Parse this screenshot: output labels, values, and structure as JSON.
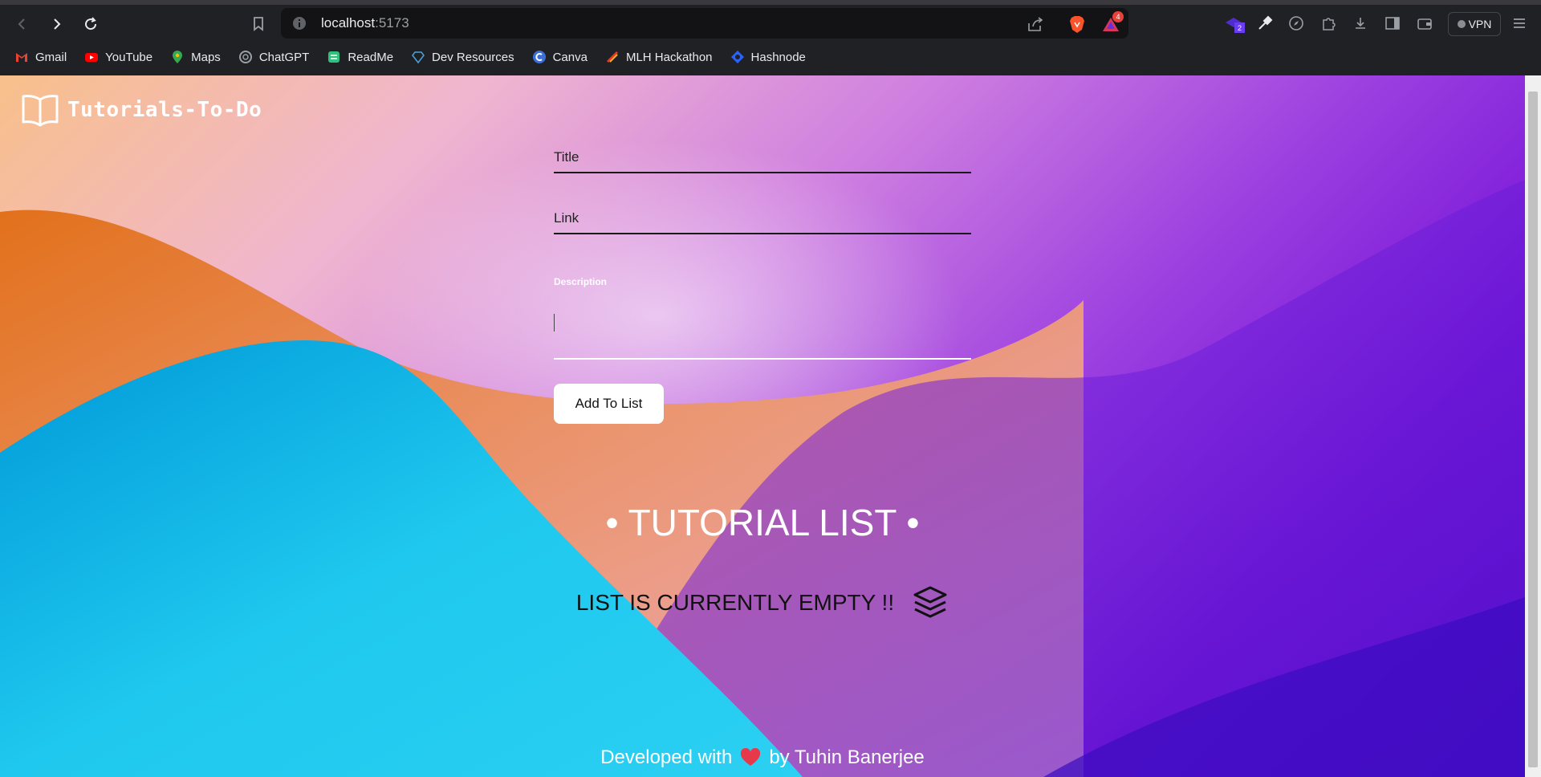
{
  "browser": {
    "url_host": "localhost",
    "url_port": ":5173",
    "vpn_label": "VPN",
    "shields_badge": "4",
    "ext_badge": "2"
  },
  "bookmarks": [
    {
      "label": "Gmail",
      "icon": "gmail-icon",
      "color": "#ea4335"
    },
    {
      "label": "YouTube",
      "icon": "youtube-icon",
      "color": "#ff0000"
    },
    {
      "label": "Maps",
      "icon": "maps-icon",
      "color": "#34a853"
    },
    {
      "label": "ChatGPT",
      "icon": "chatgpt-icon",
      "color": "#9aa0a6"
    },
    {
      "label": "ReadMe",
      "icon": "readme-icon",
      "color": "#2ec27e"
    },
    {
      "label": "Dev Resources",
      "icon": "diamond-icon",
      "color": "#4aa3df"
    },
    {
      "label": "Canva",
      "icon": "canva-icon",
      "color": "#00c4cc"
    },
    {
      "label": "MLH Hackathon",
      "icon": "mlh-icon",
      "color": "#e73427"
    },
    {
      "label": "Hashnode",
      "icon": "hashnode-icon",
      "color": "#2962ff"
    }
  ],
  "app": {
    "brand": "Tutorials-To-Do",
    "title_placeholder": "Title",
    "link_placeholder": "Link",
    "description_label": "Description",
    "add_button": "Add To List",
    "list_heading": "• TUTORIAL LIST •",
    "empty_message": "LIST IS CURRENTLY EMPTY !!",
    "footer_prefix": "Developed with",
    "footer_suffix": "by Tuhin Banerjee"
  }
}
